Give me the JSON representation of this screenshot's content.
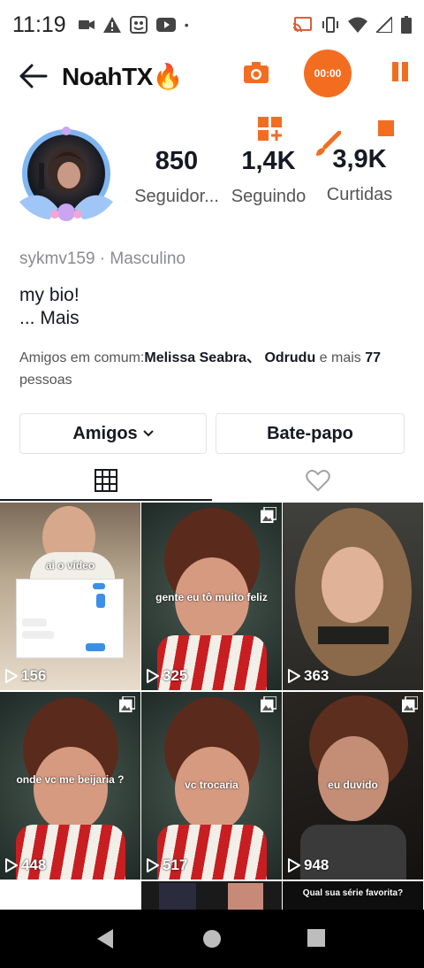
{
  "status_bar": {
    "time": "11:19"
  },
  "header": {
    "username": "NoahTX🔥",
    "record_timer": "00:00"
  },
  "stats": [
    {
      "value": "850",
      "label": "Seguidor..."
    },
    {
      "value": "1,4K",
      "label": "Seguindo"
    },
    {
      "value": "3,9K",
      "label": "Curtidas"
    }
  ],
  "profile": {
    "handle": "sykmv159 · Masculino",
    "bio": "my bio!",
    "bio_more": "...  Mais",
    "mutual_prefix": "Amigos em comum:",
    "mutual_names": "Melissa Seabra、 Odrudu",
    "mutual_middle": " e mais ",
    "mutual_count": "77",
    "mutual_suffix": "pessoas"
  },
  "buttons": {
    "friends": "Amigos",
    "chat": "Bate-papo"
  },
  "videos": [
    {
      "caption": "ai o vídeo",
      "views": "156"
    },
    {
      "caption": "gente eu tô muito feliz",
      "views": "325"
    },
    {
      "caption": "",
      "views": "363"
    },
    {
      "caption": "onde vc me beijaria ?",
      "views": "448"
    },
    {
      "caption": "vc trocaria",
      "views": "517"
    },
    {
      "caption": "eu duvido",
      "views": "948"
    }
  ],
  "partial_row": {
    "caption": "Qual sua série favorita?"
  },
  "colors": {
    "accent": "#f36d21",
    "text": "#161823",
    "muted": "#8a8b91",
    "navbar": "#000000"
  },
  "icons": [
    "back-arrow-icon",
    "camera-icon",
    "pause-icon",
    "grid-icon",
    "heart-icon",
    "play-icon",
    "multi-image-icon"
  ]
}
